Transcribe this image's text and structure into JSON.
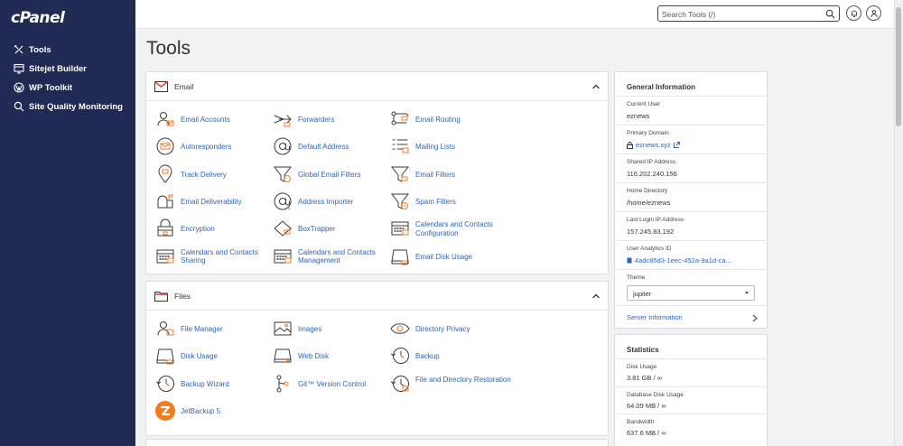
{
  "app": {
    "logo": "cPanel",
    "page_title": "Tools"
  },
  "sidebar": {
    "items": [
      {
        "label": "Tools",
        "icon": "tools-icon"
      },
      {
        "label": "Sitejet Builder",
        "icon": "sitejet-icon"
      },
      {
        "label": "WP Toolkit",
        "icon": "wordpress-icon"
      },
      {
        "label": "Site Quality Monitoring",
        "icon": "magnifier-icon"
      }
    ]
  },
  "search": {
    "placeholder": "Search Tools (/)",
    "value": ""
  },
  "email_section": {
    "title": "Email",
    "tools": [
      "Email Accounts",
      "Forwarders",
      "Email Routing",
      "Autoresponders",
      "Default Address",
      "Mailing Lists",
      "Track Delivery",
      "Global Email Filters",
      "Email Filters",
      "Email Deliverability",
      "Address Importer",
      "Spam Filters",
      "Encryption",
      "BoxTrapper",
      "Calendars and Contacts Configuration",
      "Calendars and Contacts Sharing",
      "Calendars and Contacts Management",
      "Email Disk Usage"
    ]
  },
  "files_section": {
    "title": "Files",
    "tools": [
      "File Manager",
      "Images",
      "Directory Privacy",
      "Disk Usage",
      "Web Disk",
      "Backup",
      "Backup Wizard",
      "Git™ Version Control",
      "File and Directory Restoration",
      "JetBackup 5"
    ]
  },
  "general_info": {
    "title": "General Information",
    "current_user_label": "Current User",
    "current_user": "eznews",
    "primary_domain_label": "Primary Domain",
    "primary_domain": "eznews.xyz",
    "shared_ip_label": "Shared IP Address",
    "shared_ip": "116.202.240.156",
    "home_dir_label": "Home Directory",
    "home_dir": "/home/eznews",
    "last_login_label": "Last Login IP Address",
    "last_login": "157.245.83.192",
    "analytics_label": "User Analytics ID",
    "analytics_id": "4adc85d3-1eec-452a-9a1d-ca...",
    "theme_label": "Theme",
    "theme": "jupiter",
    "server_info": "Server Information"
  },
  "statistics": {
    "title": "Statistics",
    "disk_usage_label": "Disk Usage",
    "disk_usage": "3.81 GB / ∞",
    "db_disk_label": "Database Disk Usage",
    "db_disk": "64.09 MB / ∞",
    "bandwidth_label": "Bandwidth",
    "bandwidth": "637.6 MB / ∞"
  },
  "colors": {
    "sidebar": "#202a55",
    "link": "#2e65b4",
    "icon_accent": "#f47a20",
    "background": "#f1f2f4"
  }
}
